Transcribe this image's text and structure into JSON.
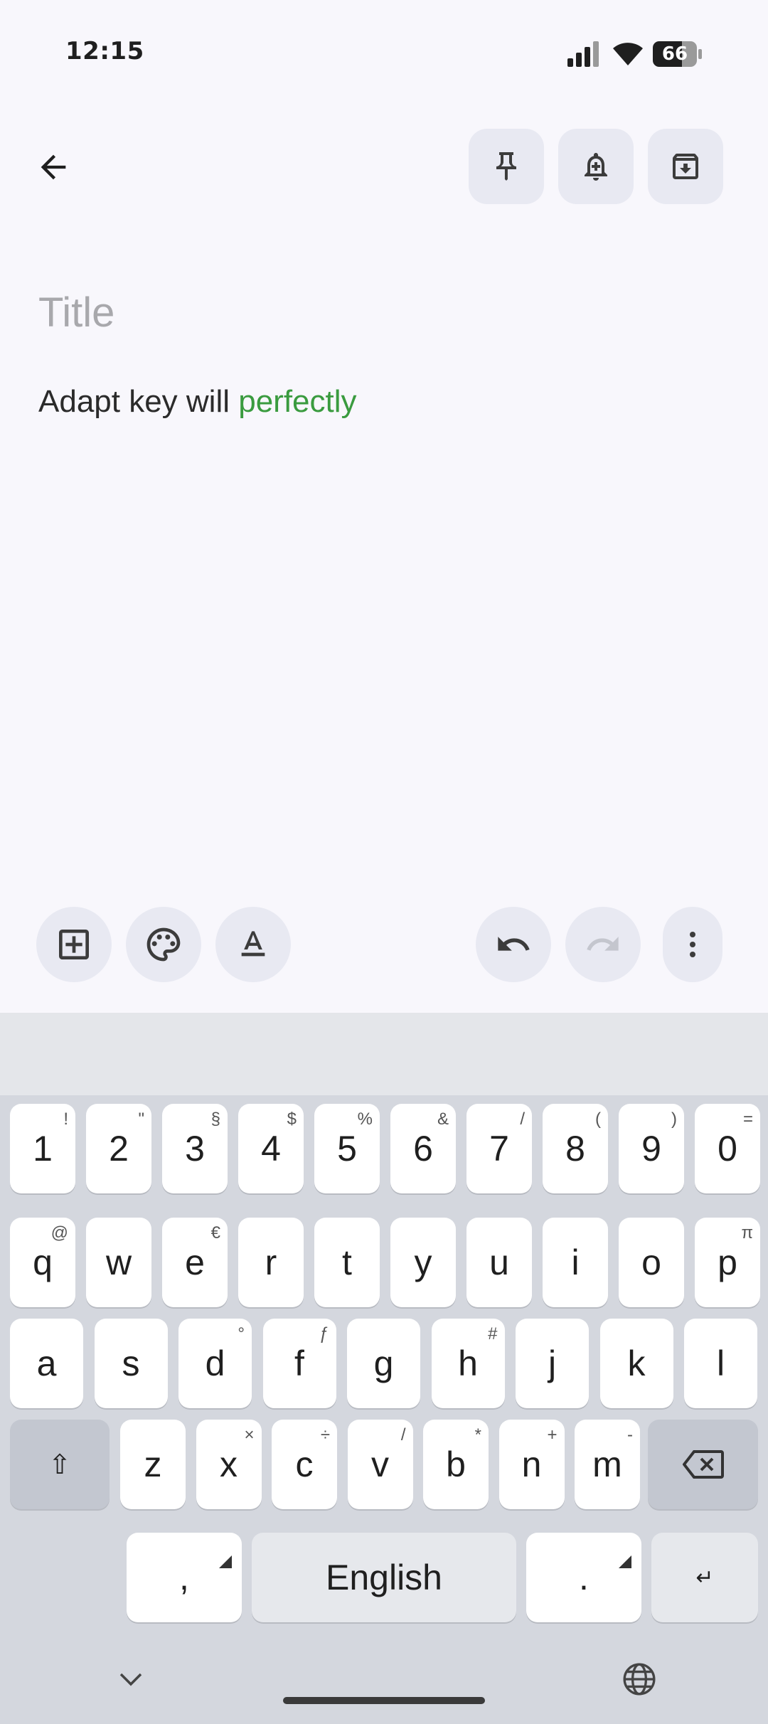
{
  "status": {
    "time": "12:15",
    "battery": "66"
  },
  "editor": {
    "title_placeholder": "Title",
    "body_plain": "Adapt key will ",
    "body_highlight": "perfectly"
  },
  "keyboard": {
    "row1": [
      {
        "k": "1",
        "s": "!"
      },
      {
        "k": "2",
        "s": "\""
      },
      {
        "k": "3",
        "s": "§"
      },
      {
        "k": "4",
        "s": "$"
      },
      {
        "k": "5",
        "s": "%"
      },
      {
        "k": "6",
        "s": "&"
      },
      {
        "k": "7",
        "s": "/"
      },
      {
        "k": "8",
        "s": "("
      },
      {
        "k": "9",
        "s": ")"
      },
      {
        "k": "0",
        "s": "="
      }
    ],
    "row2": [
      {
        "k": "q",
        "s": "@"
      },
      {
        "k": "w",
        "s": ""
      },
      {
        "k": "e",
        "s": "€"
      },
      {
        "k": "r",
        "s": ""
      },
      {
        "k": "t",
        "s": ""
      },
      {
        "k": "y",
        "s": ""
      },
      {
        "k": "u",
        "s": ""
      },
      {
        "k": "i",
        "s": ""
      },
      {
        "k": "o",
        "s": ""
      },
      {
        "k": "p",
        "s": "π"
      }
    ],
    "row3": [
      {
        "k": "a",
        "s": ""
      },
      {
        "k": "s",
        "s": ""
      },
      {
        "k": "d",
        "s": "°"
      },
      {
        "k": "f",
        "s": "ƒ"
      },
      {
        "k": "g",
        "s": ""
      },
      {
        "k": "h",
        "s": "#"
      },
      {
        "k": "j",
        "s": ""
      },
      {
        "k": "k",
        "s": ""
      },
      {
        "k": "l",
        "s": ""
      }
    ],
    "row4": [
      {
        "k": "z",
        "s": ""
      },
      {
        "k": "x",
        "s": "×"
      },
      {
        "k": "c",
        "s": "÷"
      },
      {
        "k": "v",
        "s": "/"
      },
      {
        "k": "b",
        "s": "*"
      },
      {
        "k": "n",
        "s": "+"
      },
      {
        "k": "m",
        "s": "-"
      }
    ],
    "shift": "⇧",
    "comma": ",",
    "space": "English",
    "period": ".",
    "enter": "↵",
    "hide": "⌄"
  }
}
